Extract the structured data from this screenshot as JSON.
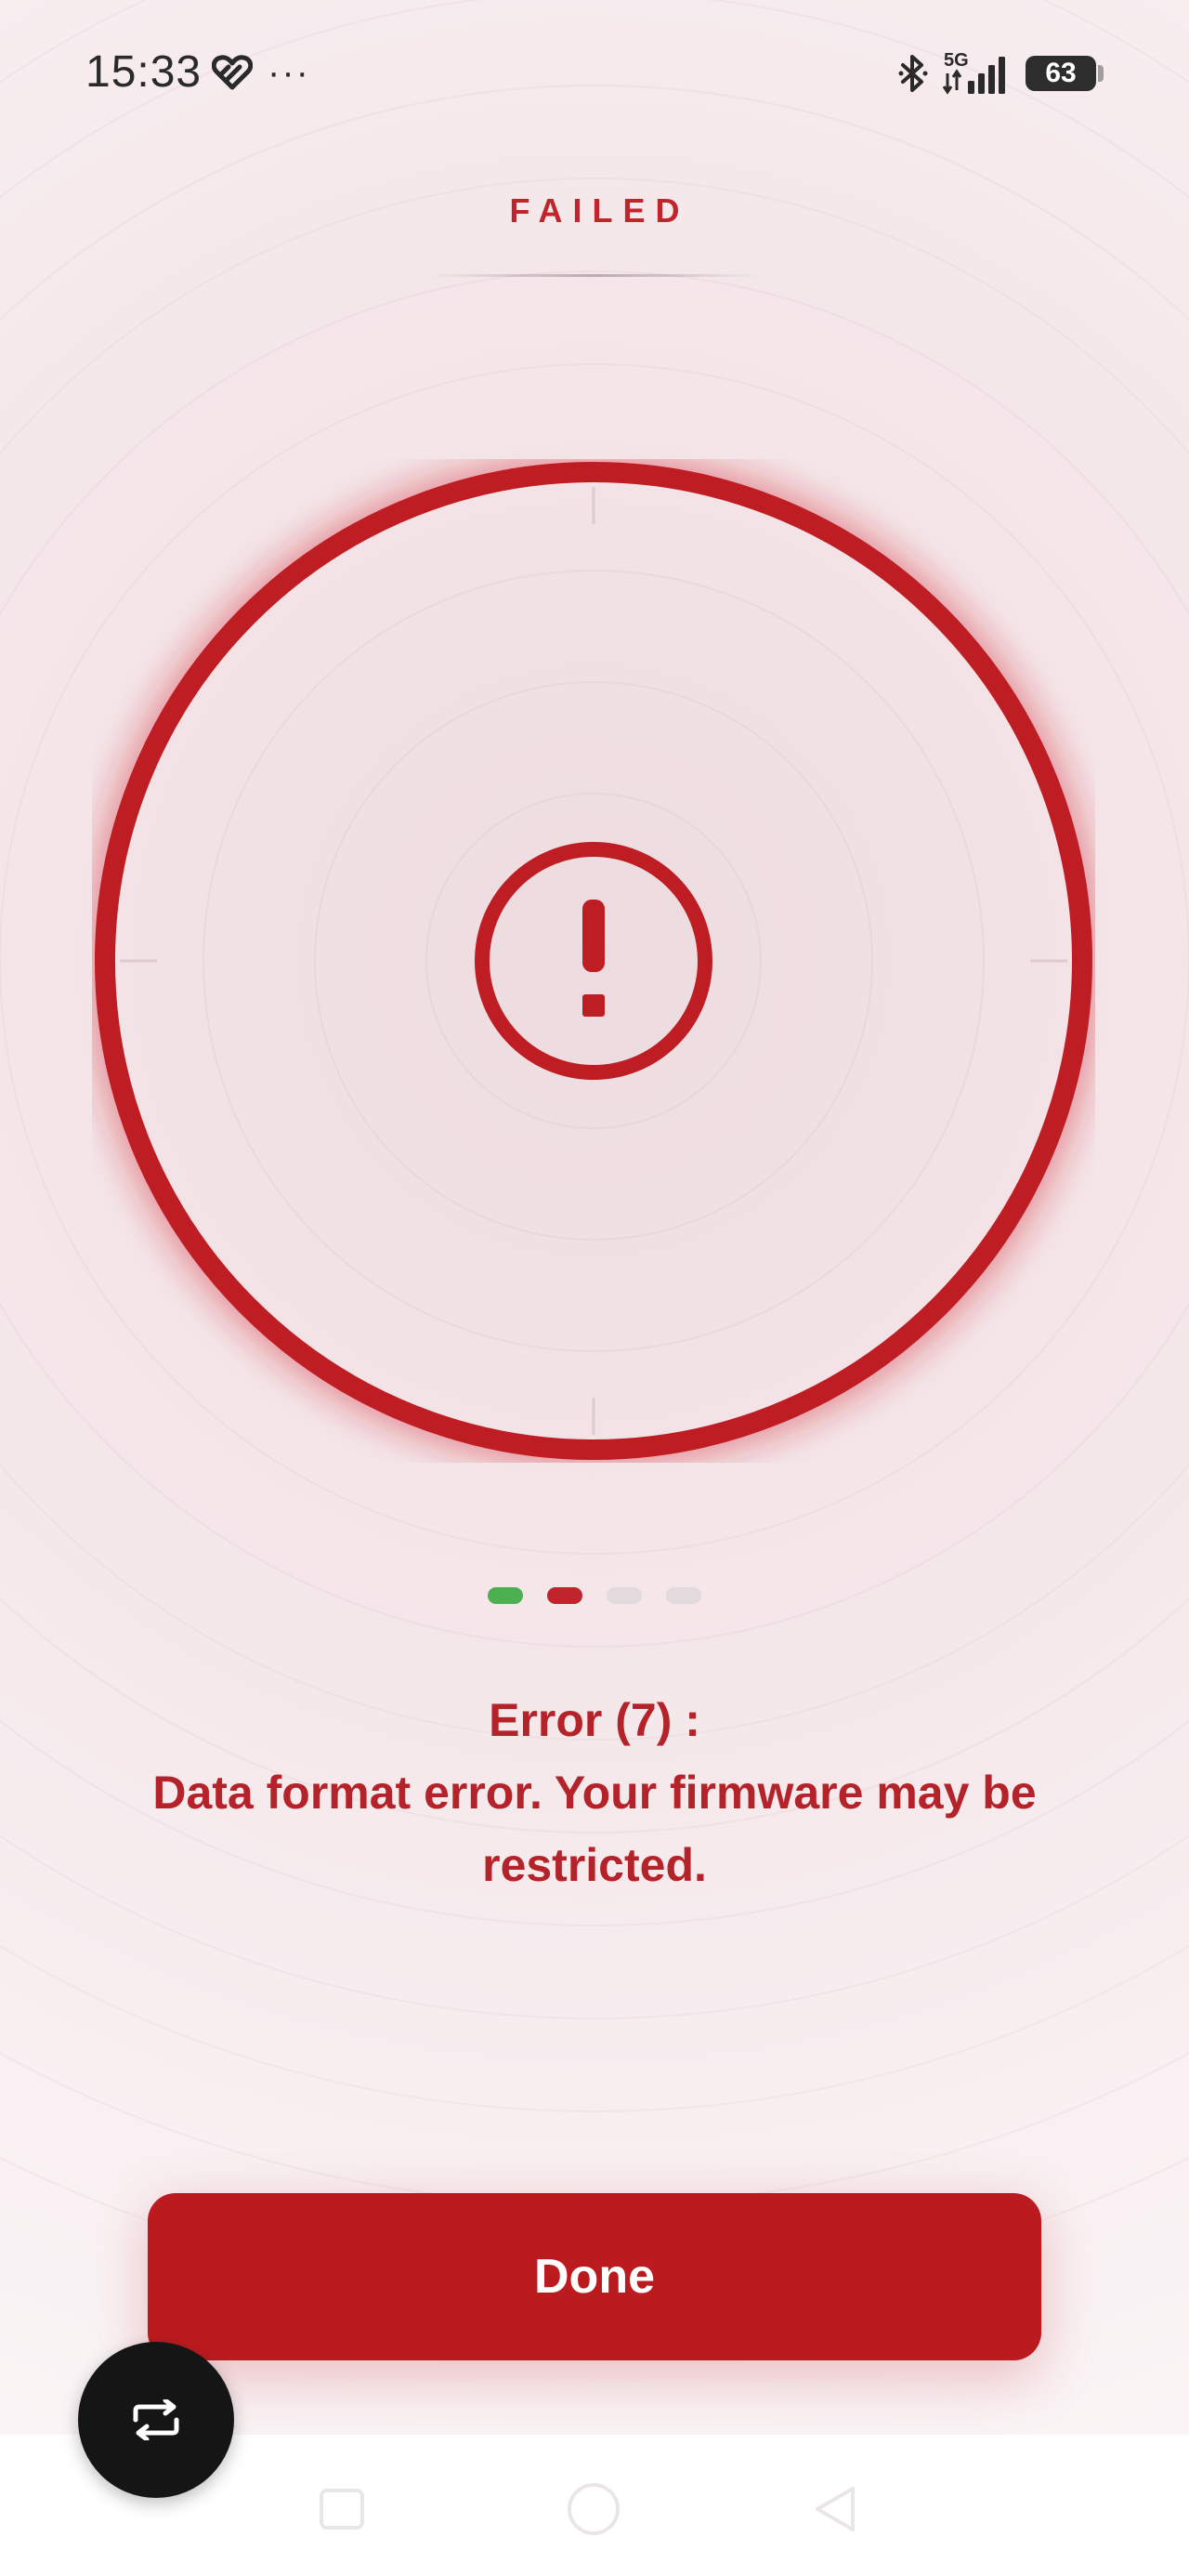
{
  "status_bar": {
    "time": "15:33",
    "more": "···",
    "network": "5G",
    "battery_level": "63",
    "icons": [
      "health-icon",
      "more-icon",
      "bluetooth-icon",
      "signal-icon",
      "battery-icon"
    ]
  },
  "header": {
    "title": "FAILED"
  },
  "status_indicator": {
    "state": "error",
    "icon": "exclamation-icon",
    "color": "#c0252b"
  },
  "progress": {
    "total_steps": 4,
    "steps": [
      {
        "state": "success",
        "color": "#4caf50"
      },
      {
        "state": "failed",
        "color": "#c0252b"
      },
      {
        "state": "pending",
        "color": "#e2dadc"
      },
      {
        "state": "pending",
        "color": "#e2dadc"
      }
    ]
  },
  "error": {
    "line1": "Error (7) :",
    "line2": "Data format error. Your firmware may be",
    "line3": "restricted."
  },
  "actions": {
    "done_label": "Done"
  },
  "fab": {
    "icon": "repeat-icon"
  },
  "navigation": {
    "icons": [
      "nav-recents-icon",
      "nav-home-icon",
      "nav-back-icon"
    ]
  },
  "colors": {
    "accent": "#bb1b1f",
    "success": "#4caf50",
    "text_error": "#b5232a"
  }
}
